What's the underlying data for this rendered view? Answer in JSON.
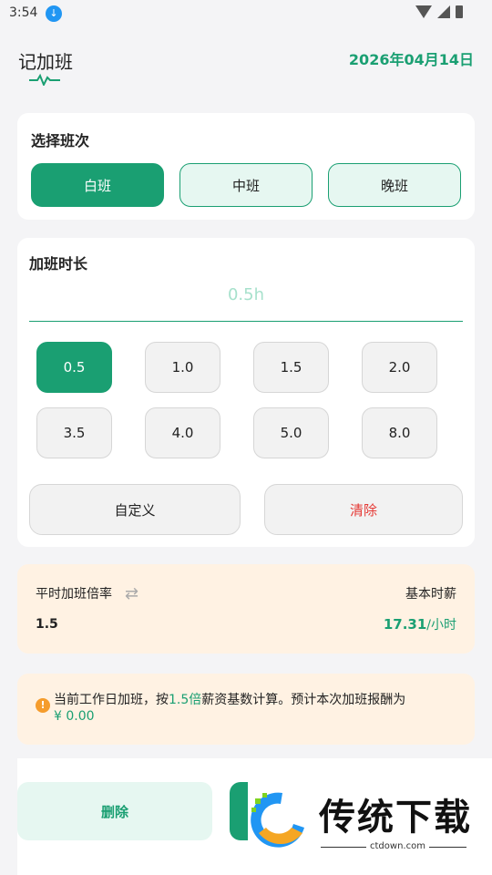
{
  "status": {
    "time": "3:54"
  },
  "header": {
    "title": "记加班",
    "date": "2026年04月14日"
  },
  "shift": {
    "title": "选择班次",
    "options": [
      "白班",
      "中班",
      "晚班"
    ],
    "selected": "白班"
  },
  "hours": {
    "title": "加班时长",
    "display": "0.5h",
    "chips": [
      "0.5",
      "1.0",
      "1.5",
      "2.0",
      "3.5",
      "4.0",
      "5.0",
      "8.0"
    ],
    "selected": "0.5",
    "custom_label": "自定义",
    "clear_label": "清除"
  },
  "rate": {
    "rate_label": "平时加班倍率",
    "rate_value": "1.5",
    "wage_label": "基本时薪",
    "wage_value": "17.31",
    "wage_unit": "/小时"
  },
  "notice": {
    "prefix": "当前工作日加班，按",
    "multiplier": "1.5倍",
    "suffix": "薪资基数计算。预计本次加班报酬为",
    "amount": "¥ 0.00"
  },
  "footer": {
    "delete_label": "删除"
  },
  "watermark": {
    "brand": "传统下载",
    "url": "ctdown.com"
  },
  "colors": {
    "accent": "#1a9f72",
    "warning": "#f59c2c",
    "danger": "#e53935",
    "info_bg": "#fff2e3"
  }
}
